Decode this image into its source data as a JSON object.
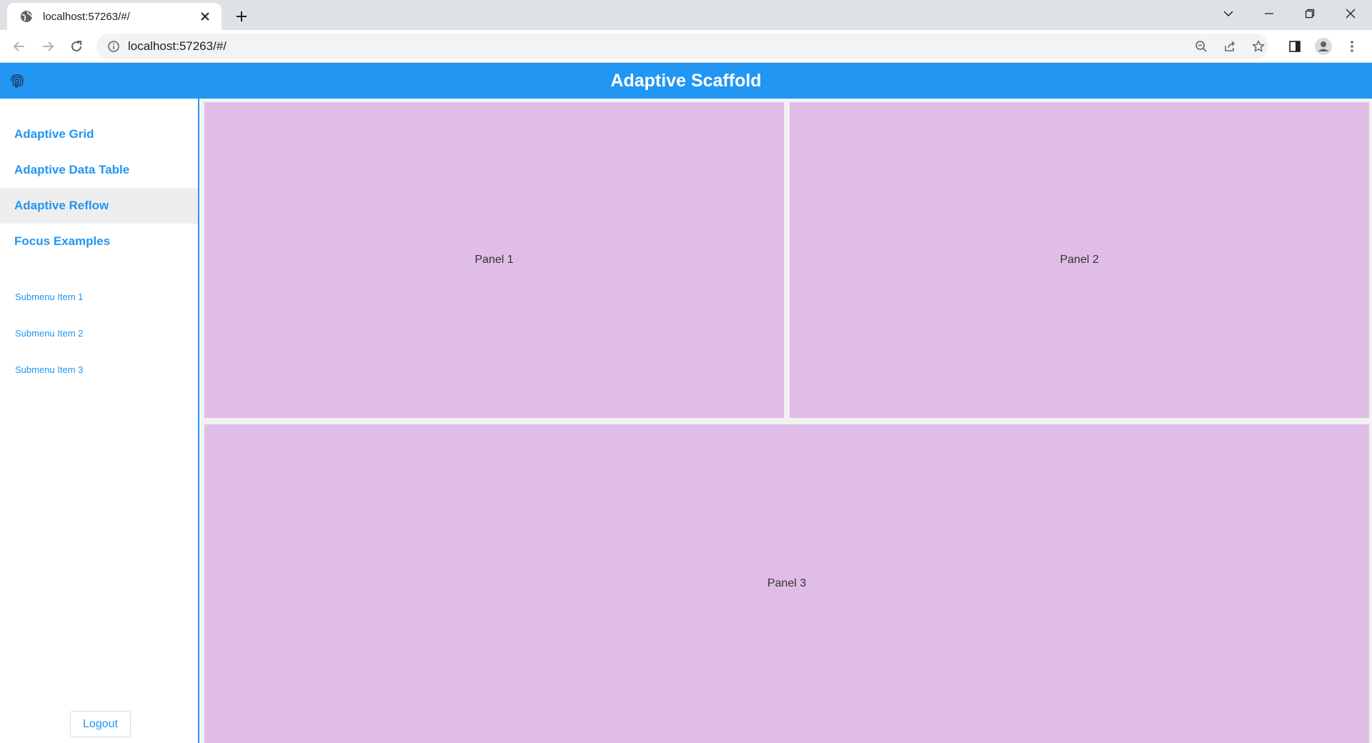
{
  "browser": {
    "tab_title": "localhost:57263/#/",
    "url": "localhost:57263/#/",
    "icons": [
      "globe-icon",
      "close-icon",
      "plus-icon",
      "chevron-down-icon",
      "minimize-icon",
      "restore-icon",
      "window-close-icon",
      "back-icon",
      "forward-icon",
      "reload-icon",
      "info-icon",
      "zoom-out-icon",
      "share-icon",
      "star-icon",
      "side-panel-icon",
      "profile-icon",
      "more-icon"
    ]
  },
  "app": {
    "title": "Adaptive Scaffold",
    "logo_icon": "fingerprint-icon",
    "accent_color": "#2196f3",
    "panel_color": "#e0bde6"
  },
  "sidebar": {
    "items": [
      {
        "label": "Adaptive Grid",
        "active": false
      },
      {
        "label": "Adaptive Data Table",
        "active": false
      },
      {
        "label": "Adaptive Reflow",
        "active": true
      },
      {
        "label": "Focus Examples",
        "active": false
      }
    ],
    "sub_items": [
      {
        "label": "Submenu Item 1"
      },
      {
        "label": "Submenu Item 2"
      },
      {
        "label": "Submenu Item 3"
      }
    ],
    "logout_label": "Logout"
  },
  "panels": [
    {
      "label": "Panel 1"
    },
    {
      "label": "Panel 2"
    },
    {
      "label": "Panel 3"
    }
  ]
}
